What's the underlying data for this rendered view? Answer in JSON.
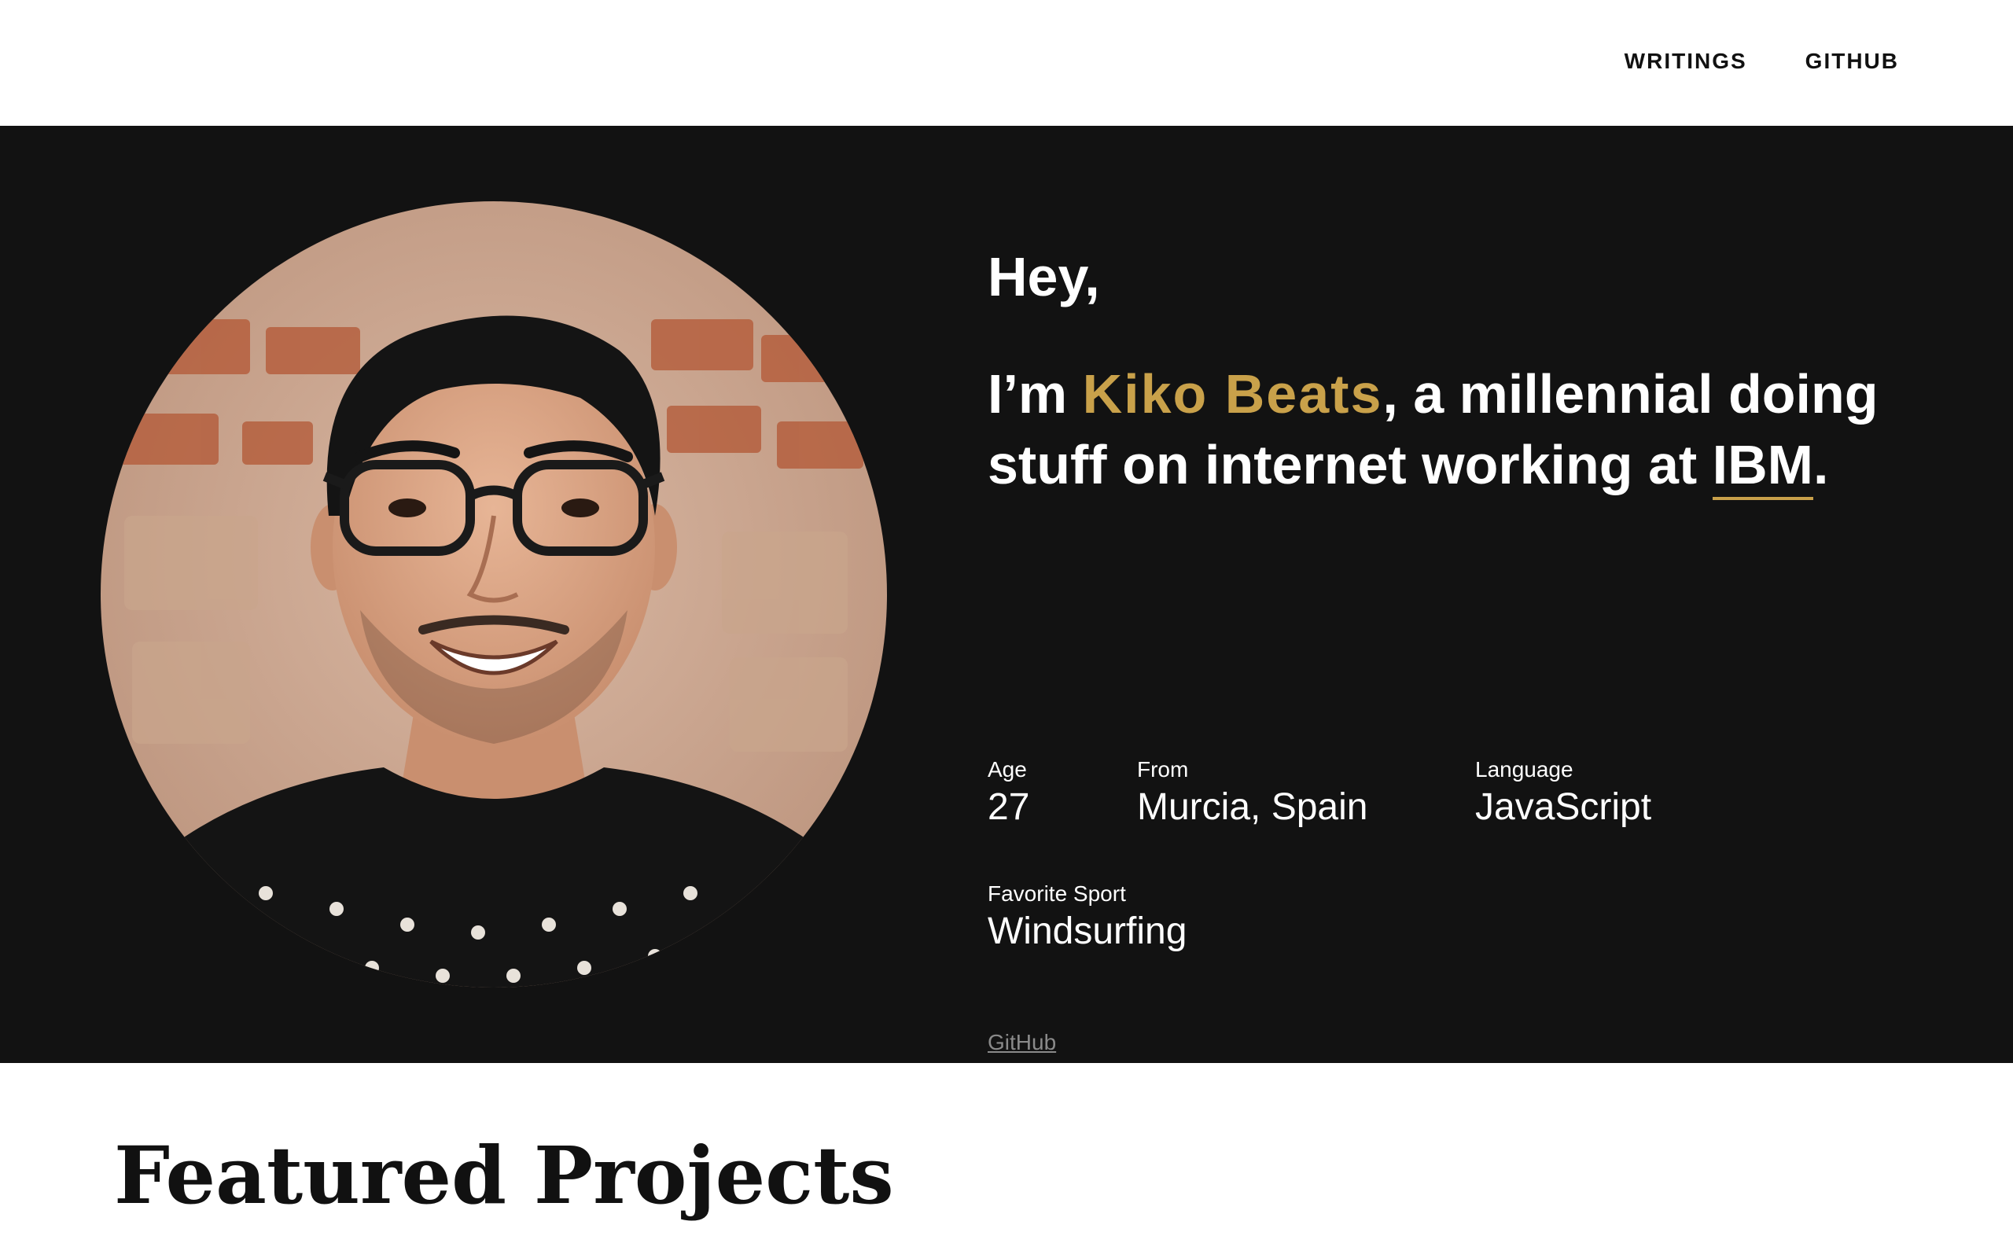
{
  "progress": {
    "fraction": 0.187
  },
  "nav": {
    "items": [
      {
        "label": "WRITINGS"
      },
      {
        "label": "GITHUB"
      }
    ]
  },
  "hero": {
    "greeting": "Hey,",
    "headline_prefix": "I’m ",
    "name": "Kiko Beats",
    "headline_middle": ", a millennial doing stuff on internet working at ",
    "company": "IBM",
    "headline_suffix": ".",
    "facts": [
      {
        "label": "Age",
        "value": "27"
      },
      {
        "label": "From",
        "value": "Murcia, Spain"
      },
      {
        "label": "Language",
        "value": "JavaScript"
      },
      {
        "label": "Favorite Sport",
        "value": "Windsurfing"
      }
    ],
    "github_link": "GitHub"
  },
  "colors": {
    "accent": "#c9a14a",
    "hero_background": "#121212",
    "link_muted": "#8a8a8a"
  },
  "sections": {
    "projects_title": "Featured Projects"
  }
}
